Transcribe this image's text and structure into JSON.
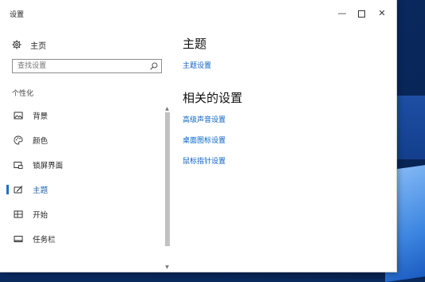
{
  "window": {
    "title": "设置",
    "minimize_glyph": "—",
    "close_glyph": "✕"
  },
  "nav": {
    "home_label": "主页",
    "search_placeholder": "查找设置",
    "section_label": "个性化",
    "items": [
      {
        "label": "背景",
        "icon": "picture-icon"
      },
      {
        "label": "颜色",
        "icon": "palette-icon"
      },
      {
        "label": "锁屏界面",
        "icon": "lockscreen-icon"
      },
      {
        "label": "主题",
        "icon": "theme-brush-icon",
        "active": true
      },
      {
        "label": "开始",
        "icon": "start-tiles-icon"
      },
      {
        "label": "任务栏",
        "icon": "taskbar-icon"
      }
    ]
  },
  "content": {
    "heading": "主题",
    "theme_link": "主题设置",
    "related_heading": "相关的设置",
    "related_links": [
      "高级声音设置",
      "桌面图标设置",
      "鼠标指针设置"
    ]
  },
  "colors": {
    "accent": "#1a73d0",
    "link": "#0b63c4",
    "desktop": "#0b3a84"
  }
}
